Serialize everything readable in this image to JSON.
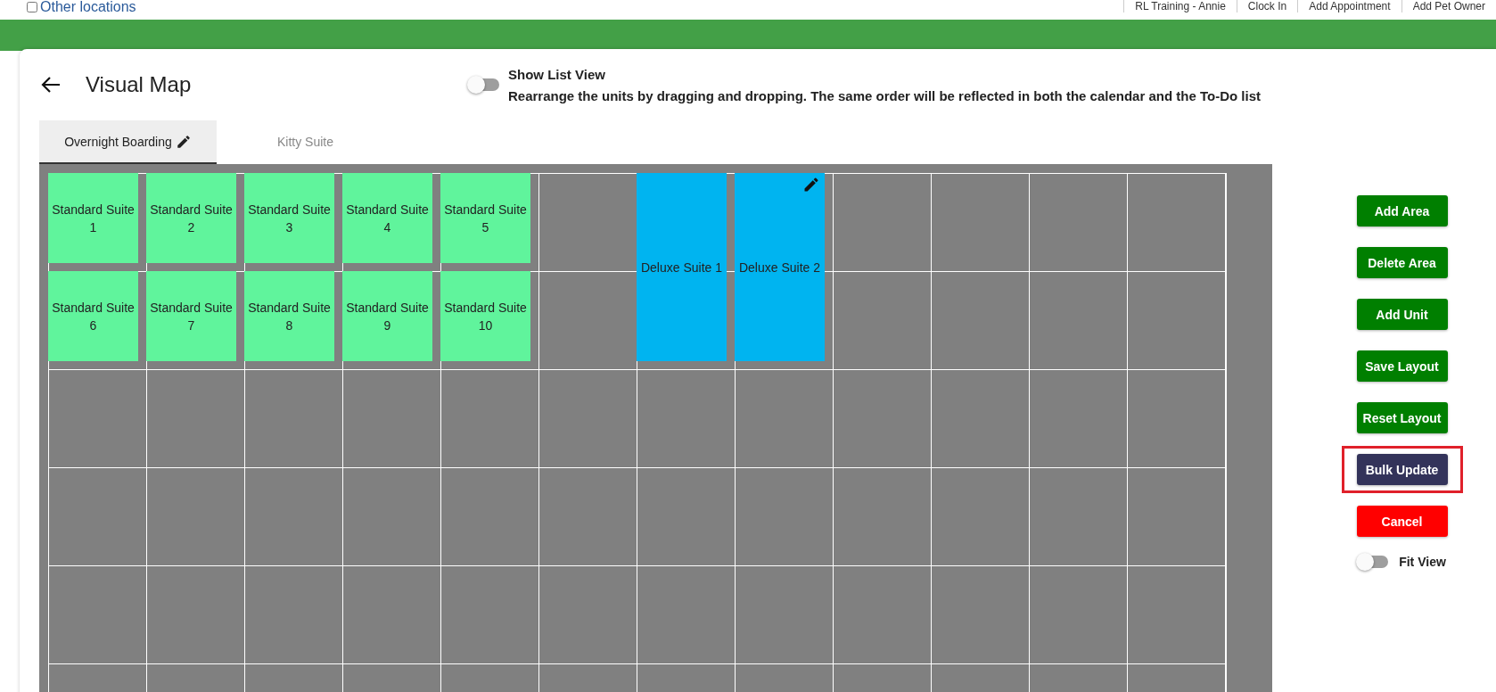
{
  "top_bar": {
    "location_filter": {
      "label": "Other locations",
      "checked": false
    },
    "links": [
      "RL Training - Annie",
      "Clock In",
      "Add Appointment",
      "Add Pet Owner"
    ]
  },
  "header": {
    "title": "Visual Map",
    "list_view_toggle": {
      "label": "Show List View",
      "on": false
    },
    "description": "Rearrange the units by dragging and dropping. The same order will be reflected in both the calendar and the To-Do list"
  },
  "tabs": [
    {
      "label": "Overnight Boarding",
      "selected": true,
      "editable": true
    },
    {
      "label": "Kitty Suite",
      "selected": false,
      "editable": false
    }
  ],
  "map": {
    "units": [
      {
        "name": "Standard Suite 1",
        "kind": "standard",
        "color": "#60f49c",
        "editable": false
      },
      {
        "name": "Standard Suite 2",
        "kind": "standard",
        "color": "#60f49c",
        "editable": false
      },
      {
        "name": "Standard Suite 3",
        "kind": "standard",
        "color": "#60f49c",
        "editable": false
      },
      {
        "name": "Standard Suite 4",
        "kind": "standard",
        "color": "#60f49c",
        "editable": false
      },
      {
        "name": "Standard Suite 5",
        "kind": "standard",
        "color": "#60f49c",
        "editable": false
      },
      {
        "name": "Deluxe Suite 1",
        "kind": "deluxe",
        "color": "#00b4f0",
        "editable": false
      },
      {
        "name": "Deluxe Suite 2",
        "kind": "deluxe",
        "color": "#00b4f0",
        "editable": true
      },
      {
        "name": "Standard Suite 6",
        "kind": "standard",
        "color": "#60f49c",
        "editable": false
      },
      {
        "name": "Standard Suite 7",
        "kind": "standard",
        "color": "#60f49c",
        "editable": false
      },
      {
        "name": "Standard Suite 8",
        "kind": "standard",
        "color": "#60f49c",
        "editable": false
      },
      {
        "name": "Standard Suite 9",
        "kind": "standard",
        "color": "#60f49c",
        "editable": false
      },
      {
        "name": "Standard Suite 10",
        "kind": "standard",
        "color": "#60f49c",
        "editable": false
      }
    ]
  },
  "actions": [
    {
      "label": "Add Area",
      "kind": "primary",
      "highlighted": false
    },
    {
      "label": "Delete Area",
      "kind": "primary",
      "highlighted": false
    },
    {
      "label": "Add Unit",
      "kind": "primary",
      "highlighted": false
    },
    {
      "label": "Save Layout",
      "kind": "primary",
      "highlighted": false
    },
    {
      "label": "Reset Layout",
      "kind": "primary",
      "highlighted": false
    },
    {
      "label": "Bulk Update",
      "kind": "secondary",
      "highlighted": true
    },
    {
      "label": "Cancel",
      "kind": "danger",
      "highlighted": false
    }
  ],
  "fit_view_toggle": {
    "label": "Fit View",
    "on": false
  }
}
